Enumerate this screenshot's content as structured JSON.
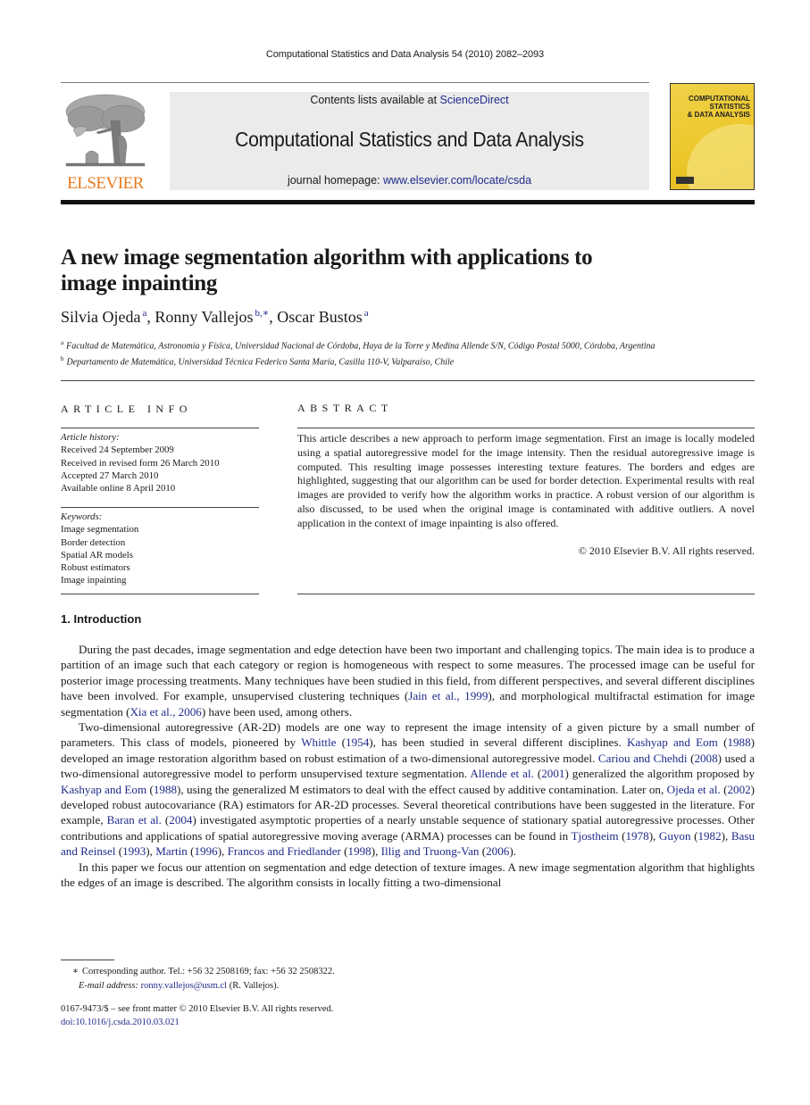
{
  "running_head": "Computational Statistics and Data Analysis 54 (2010) 2082–2093",
  "masthead": {
    "publisher": "ELSEVIER",
    "contents_prefix": "Contents lists available at ",
    "contents_link": "ScienceDirect",
    "journal_title": "Computational Statistics and Data Analysis",
    "homepage_prefix": "journal homepage: ",
    "homepage_link": "www.elsevier.com/locate/csda",
    "cover_title_lines": [
      "COMPUTATIONAL",
      "STATISTICS",
      "& DATA ANALYSIS"
    ]
  },
  "article": {
    "title_line1": "A new image segmentation algorithm with applications to",
    "title_line2": "image inpainting",
    "authors": [
      {
        "name": "Silvia Ojeda",
        "sup": "a",
        "sep": ", "
      },
      {
        "name": "Ronny Vallejos",
        "sup": "b,∗",
        "sep": ", "
      },
      {
        "name": "Oscar Bustos",
        "sup": "a",
        "sep": ""
      }
    ],
    "affiliations": [
      {
        "mark": "a",
        "text": "Facultad de Matemática, Astronomía y Física, Universidad Nacional de Córdoba, Haya de la Torre y Medina Allende S/N, Código Postal 5000, Córdoba, Argentina"
      },
      {
        "mark": "b",
        "text": "Departamento de Matemática, Universidad Técnica Federico Santa María, Casilla 110-V, Valparaíso, Chile"
      }
    ]
  },
  "article_info": {
    "label": "ARTICLE INFO",
    "history_header": "Article history:",
    "history": [
      "Received 24 September 2009",
      "Received in revised form 26 March 2010",
      "Accepted 27 March 2010",
      "Available online 8 April 2010"
    ],
    "keywords_header": "Keywords:",
    "keywords": [
      "Image segmentation",
      "Border detection",
      "Spatial AR models",
      "Robust estimators",
      "Image inpainting"
    ]
  },
  "abstract": {
    "label": "ABSTRACT",
    "text": "This article describes a new approach to perform image segmentation. First an image is locally modeled using a spatial autoregressive model for the image intensity. Then the residual autoregressive image is computed. This resulting image possesses interesting texture features. The borders and edges are highlighted, suggesting that our algorithm can be used for border detection. Experimental results with real images are provided to verify how the algorithm works in practice. A robust version of our algorithm is also discussed, to be used when the original image is contaminated with additive outliers. A novel application in the context of image inpainting is also offered.",
    "copyright": "© 2010 Elsevier B.V. All rights reserved."
  },
  "introduction": {
    "heading": "1.  Introduction",
    "paragraphs": [
      [
        {
          "t": "During the past decades, image segmentation and edge detection have been two important and challenging topics. The main idea is to produce a partition of an image such that each category or region is homogeneous with respect to some measures. The processed image can be useful for posterior image processing treatments. Many techniques have been studied in this field, from different perspectives, and several different disciplines have been involved. For example, unsupervised clustering techniques ("
        },
        {
          "link": "Jain et al., 1999"
        },
        {
          "t": "), and morphological multifractal estimation for image segmentation ("
        },
        {
          "link": "Xia et al., 2006"
        },
        {
          "t": ") have been used, among others."
        }
      ],
      [
        {
          "t": "Two-dimensional autoregressive (AR-2D) models are one way to represent the image intensity of a given picture by a small number of parameters. This class of models, pioneered by "
        },
        {
          "link": "Whittle"
        },
        {
          "t": " ("
        },
        {
          "link": "1954"
        },
        {
          "t": "), has been studied in several different disciplines. "
        },
        {
          "link": "Kashyap and Eom"
        },
        {
          "t": " ("
        },
        {
          "link": "1988"
        },
        {
          "t": ") developed an image restoration algorithm based on robust estimation of a two-dimensional autoregressive model. "
        },
        {
          "link": "Cariou and Chehdi"
        },
        {
          "t": " ("
        },
        {
          "link": "2008"
        },
        {
          "t": ") used a two-dimensional autoregressive model to perform unsupervised texture segmentation. "
        },
        {
          "link": "Allende et al."
        },
        {
          "t": " ("
        },
        {
          "link": "2001"
        },
        {
          "t": ") generalized the algorithm proposed by "
        },
        {
          "link": "Kashyap and Eom"
        },
        {
          "t": " ("
        },
        {
          "link": "1988"
        },
        {
          "t": "), using the generalized M estimators to deal with the effect caused by additive contamination. Later on, "
        },
        {
          "link": "Ojeda et al."
        },
        {
          "t": " ("
        },
        {
          "link": "2002"
        },
        {
          "t": ") developed robust autocovariance (RA) estimators for AR-2D processes. Several theoretical contributions have been suggested in the literature. For example, "
        },
        {
          "link": "Baran et al."
        },
        {
          "t": " ("
        },
        {
          "link": "2004"
        },
        {
          "t": ") investigated asymptotic properties of a nearly unstable sequence of stationary spatial autoregressive processes. Other contributions and applications of spatial autoregressive moving average (ARMA) processes can be found in "
        },
        {
          "link": "Tjostheim"
        },
        {
          "t": " ("
        },
        {
          "link": "1978"
        },
        {
          "t": "), "
        },
        {
          "link": "Guyon"
        },
        {
          "t": " ("
        },
        {
          "link": "1982"
        },
        {
          "t": "), "
        },
        {
          "link": "Basu and Reinsel"
        },
        {
          "t": " ("
        },
        {
          "link": "1993"
        },
        {
          "t": "), "
        },
        {
          "link": "Martin"
        },
        {
          "t": " ("
        },
        {
          "link": "1996"
        },
        {
          "t": "), "
        },
        {
          "link": "Francos and Friedlander"
        },
        {
          "t": " ("
        },
        {
          "link": "1998"
        },
        {
          "t": "), "
        },
        {
          "link": "Illig and Truong-Van"
        },
        {
          "t": " ("
        },
        {
          "link": "2006"
        },
        {
          "t": ")."
        }
      ],
      [
        {
          "t": "In this paper we focus our attention on segmentation and edge detection of texture images. A new image segmentation algorithm that highlights the edges of an image is described. The algorithm consists in locally fitting a two-dimensional"
        }
      ]
    ]
  },
  "footnotes": {
    "star": "∗",
    "corresponding": "Corresponding author. Tel.: +56 32 2508169; fax: +56 32 2508322.",
    "email_label": "E-mail address: ",
    "email": "ronny.vallejos@usm.cl",
    "email_suffix": " (R. Vallejos).",
    "issn": "0167-9473/$ – see front matter © 2010 Elsevier B.V. All rights reserved.",
    "doi": "doi:10.1016/j.csda.2010.03.021"
  },
  "colors": {
    "link": "#1f2a8a",
    "elsevier_orange": "#e77a1f",
    "masthead_bg": "#ebebeb",
    "cover_yellow": "#ecc82c"
  }
}
